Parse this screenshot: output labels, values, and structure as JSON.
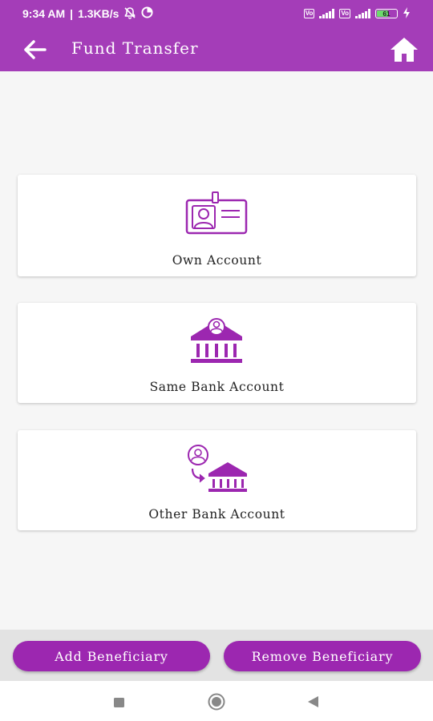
{
  "status_bar": {
    "time": "9:34 AM",
    "separator": "|",
    "speed": "1.3KB/s",
    "battery_level": "61",
    "icons": [
      "mute-bell-icon",
      "data-saver-icon",
      "volte-icon",
      "signal-icon",
      "battery-icon",
      "charging-icon"
    ]
  },
  "header": {
    "title": "Fund Transfer",
    "back_icon": "arrow-left-icon",
    "home_icon": "home-icon"
  },
  "options": [
    {
      "label": "Own Account",
      "icon": "id-card-icon"
    },
    {
      "label": "Same Bank Account",
      "icon": "bank-user-icon"
    },
    {
      "label": "Other Bank Account",
      "icon": "transfer-bank-icon"
    }
  ],
  "actions": {
    "add_label": "Add Beneficiary",
    "remove_label": "Remove Beneficiary"
  },
  "nav": {
    "icons": [
      "recents-square-icon",
      "home-circle-icon",
      "back-triangle-icon"
    ]
  },
  "colors": {
    "primary": "#a43db8",
    "button": "#9c27b0",
    "icon": "#9c27b0",
    "background": "#f6f6f6"
  }
}
